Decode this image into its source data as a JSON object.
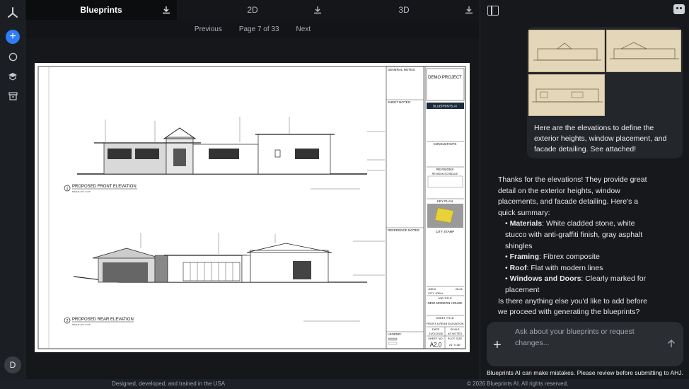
{
  "tabs": [
    {
      "label": "Blueprints",
      "active": true
    },
    {
      "label": "2D",
      "active": false
    },
    {
      "label": "3D",
      "active": false
    }
  ],
  "pager": {
    "prev": "Previous",
    "page": "Page 7 of 33",
    "next": "Next"
  },
  "sheet": {
    "front_title": "PROPOSED FRONT ELEVATION",
    "front_num": "1",
    "rear_title": "PROPOSED REAR ELEVATION",
    "rear_num": "2",
    "scale": "SCALE: 1/4\" = 1'-0\"",
    "general_notes": "GENERAL NOTES:",
    "sheet_notes": "SHEET NOTES:",
    "reference_notes": "REFERENCE NOTES:",
    "legend": "LEGEND:",
    "project": "DEMO PROJECT",
    "brand": "BLUEPRINTS AI",
    "consultants": "CONSULTANTS",
    "revisions": "REVISIONS",
    "revision_schedule": "REVISION SCHEDULE",
    "key_plan": "KEY PLAN",
    "city_stamp": "CITY STAMP",
    "job_no_label": "JOB #",
    "job_no": "26-01",
    "city_job_label": "CITY JOB #",
    "job_title_label": "JOB TITLE",
    "job_title": "NEW MODERN HOUSE",
    "sheet_title_label": "SHEET TITLE",
    "sheet_title": "FRONT & REAR ELEVATION",
    "date_label": "DATE",
    "date": "01/01/2026",
    "scale_label": "SCALE",
    "scale_val": "AS NOTED",
    "sheet_no_label": "SHEET NO.",
    "sheet_no": "A2.0",
    "plot_size_label": "PLOT SIZE",
    "plot_size": "24\" X 36\""
  },
  "chat": {
    "user_text": "Here are the elevations to define the exterior heights, window placement, and facade detailing. See attached!",
    "ai_intro": "Thanks for the elevations! They provide great detail on the exterior heights, window placements, and facade detailing. Here's a quick summary:",
    "items": [
      {
        "k": "Materials",
        "v": ": White cladded stone, white stucco with anti-graffiti finish, gray asphalt shingles"
      },
      {
        "k": "Framing",
        "v": ": Fibrex composite"
      },
      {
        "k": "Roof",
        "v": ": Flat with modern lines"
      },
      {
        "k": "Windows and Doors",
        "v": ": Clearly marked for placement"
      }
    ],
    "ai_outro": "Is there anything else you'd like to add before we proceed with generating the blueprints?",
    "placeholder": "Ask about your blueprints or request changes...",
    "disclaimer": "Blueprints AI can make mistakes. Please review before submitting to AHJ."
  },
  "rail": {
    "avatar": "D"
  },
  "footer": {
    "left": "Designed, developed, and trained in the USA",
    "right": "© 2026 Blueprints AI. All rights reserved."
  },
  "colors": {
    "accent": "#2f7cf6",
    "key_plan": "#e8d23a"
  }
}
